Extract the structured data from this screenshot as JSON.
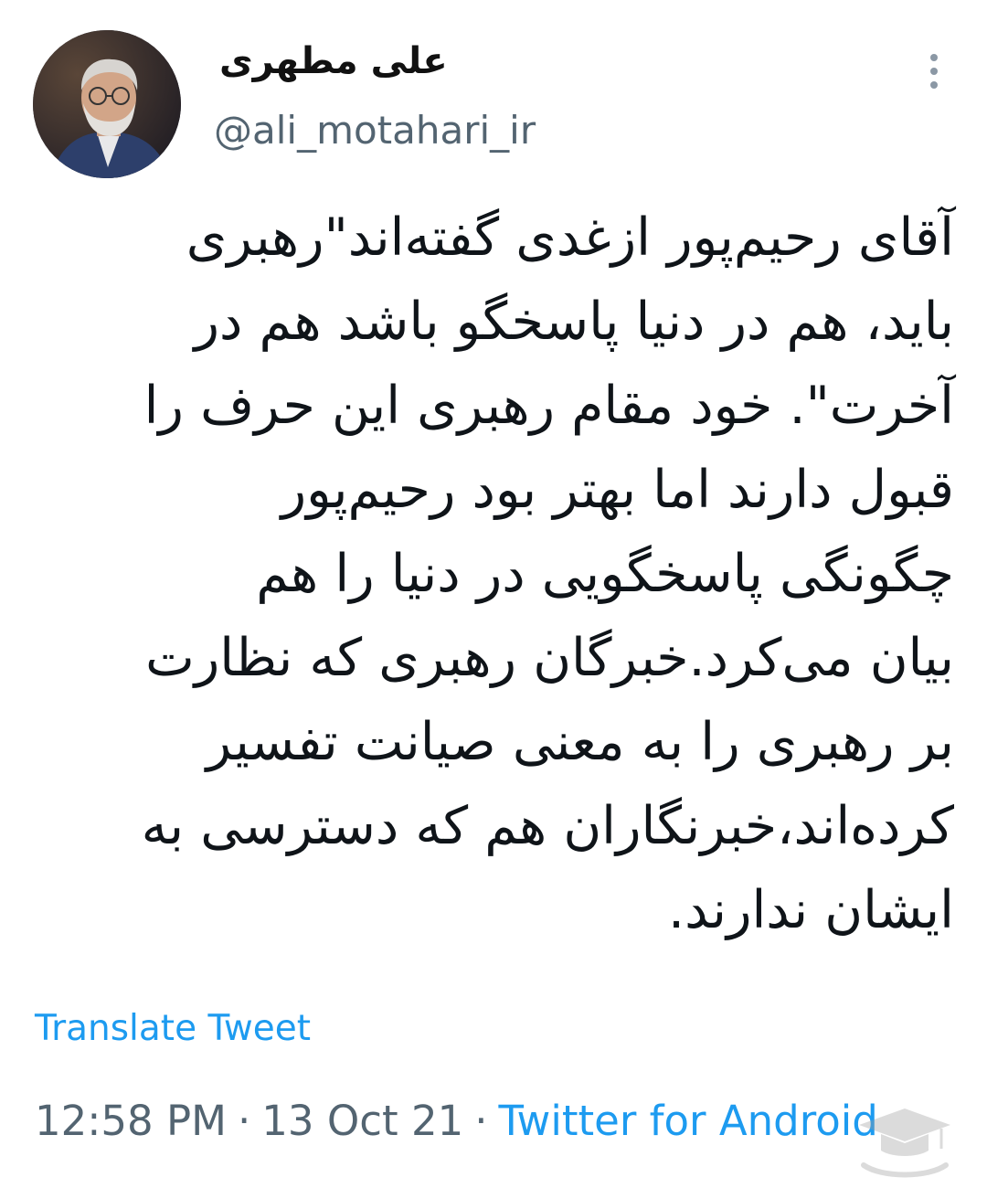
{
  "author": {
    "display_name": "علی مطهری",
    "handle": "@ali_motahari_ir",
    "avatar_icon": "profile-photo"
  },
  "tweet": {
    "lines": [
      "آقای رحیم‌پور ازغدی گفته‌اند\"رهبری",
      "باید، هم در دنیا پاسخگو باشد هم در",
      "آخرت\". خود مقام رهبری این حرف را",
      "قبول دارند اما بهتر بود رحیم‌پور",
      "چگونگی پاسخگویی در دنیا را هم",
      "بیان می‌کرد.خبرگان رهبری که نظارت",
      "بر رهبری را به معنی صیانت تفسیر",
      "کرده‌اند،خبرنگاران هم که دسترسی به",
      "ایشان ندارند."
    ]
  },
  "actions": {
    "translate_label": "Translate Tweet",
    "more_icon": "more-vertical-icon"
  },
  "meta": {
    "time": "12:58 PM",
    "separator": "·",
    "date": "13 Oct 21",
    "source": "Twitter for Android"
  },
  "colors": {
    "link": "#1d9bf0",
    "secondary_text": "#536471",
    "primary_text": "#0f1419"
  }
}
